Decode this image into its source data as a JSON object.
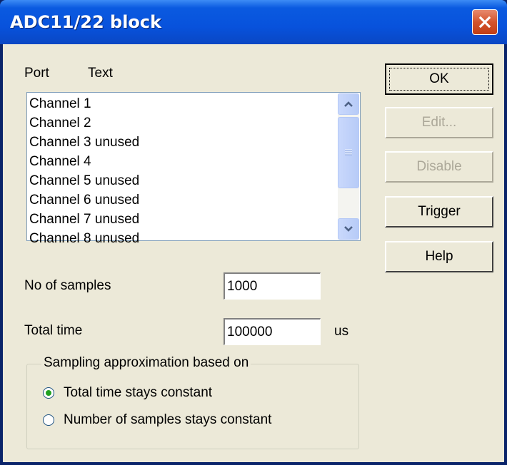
{
  "window": {
    "title": "ADC11/22 block"
  },
  "list": {
    "headers": [
      "Port",
      "Text"
    ],
    "items": [
      "Channel 1",
      "Channel 2",
      "Channel 3 unused",
      "Channel 4",
      "Channel 5 unused",
      "Channel 6 unused",
      "Channel 7 unused",
      "Channel 8 unused"
    ]
  },
  "buttons": {
    "ok": "OK",
    "edit": "Edit...",
    "disable": "Disable",
    "trigger": "Trigger",
    "help": "Help"
  },
  "fields": {
    "samples_label": "No of samples",
    "samples_value": "1000",
    "time_label": "Total time",
    "time_value": "100000",
    "time_unit": "us"
  },
  "sampling": {
    "title": "Sampling approximation based on",
    "options": [
      {
        "label": "Total time stays constant",
        "selected": true
      },
      {
        "label": "Number of samples stays constant",
        "selected": false
      }
    ]
  },
  "colors": {
    "titlebar": "#0852dc",
    "dialog_bg": "#ece9d8",
    "close_button": "#d3532c",
    "disabled_text": "#aca899"
  }
}
